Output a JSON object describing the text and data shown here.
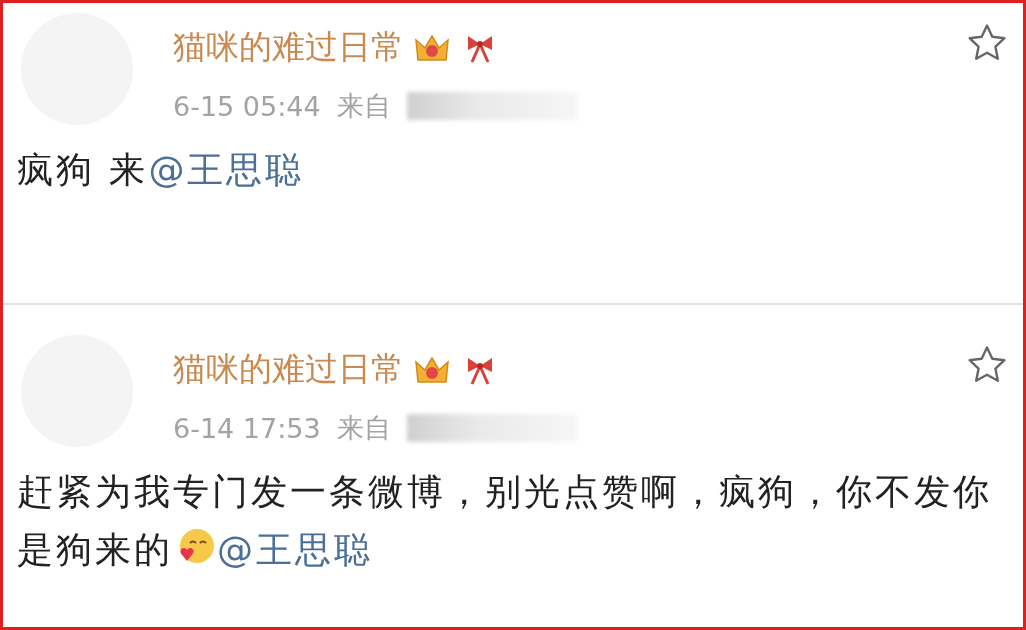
{
  "posts": [
    {
      "author": "猫咪的难过日常",
      "time": "6-15 05:44",
      "source_label": "来自",
      "starred": false,
      "content": [
        {
          "kind": "text",
          "text": "疯狗 来"
        },
        {
          "kind": "mention",
          "text": "@王思聪"
        }
      ]
    },
    {
      "author": "猫咪的难过日常",
      "time": "6-14 17:53",
      "source_label": "来自",
      "starred": false,
      "content": [
        {
          "kind": "text",
          "text": "赶紧为我专门发一条微博，别光点赞啊，疯狗，你不发你是狗来的"
        },
        {
          "kind": "emoji"
        },
        {
          "kind": "mention",
          "text": "@王思聪"
        }
      ]
    }
  ]
}
